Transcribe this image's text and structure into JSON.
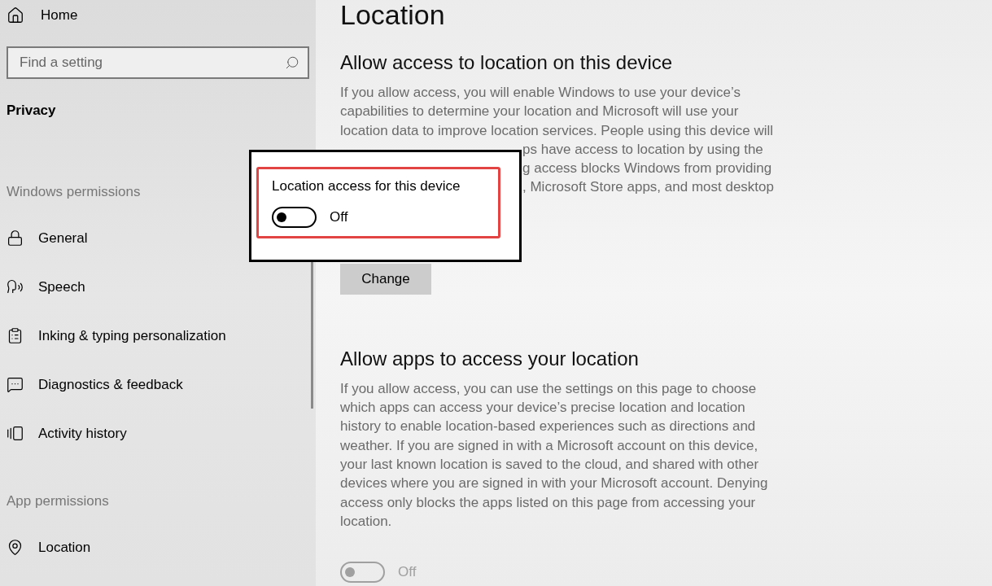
{
  "sidebar": {
    "home": {
      "label": "Home"
    },
    "search": {
      "placeholder": "Find a setting"
    },
    "section_title": "Privacy",
    "groups": [
      {
        "title": "Windows permissions",
        "items": [
          {
            "label": "General"
          },
          {
            "label": "Speech"
          },
          {
            "label": "Inking & typing personalization"
          },
          {
            "label": "Diagnostics & feedback"
          },
          {
            "label": "Activity history"
          }
        ]
      },
      {
        "title": "App permissions",
        "items": [
          {
            "label": "Location"
          }
        ]
      }
    ]
  },
  "main": {
    "title": "Location",
    "sections": [
      {
        "heading": "Allow access to location on this device",
        "paragraph_lines": [
          {
            "kind": "full",
            "text": "If you allow access, you will enable Windows to use your device’s"
          },
          {
            "kind": "full",
            "text": "capabilities to determine your location and Microsoft will use your"
          },
          {
            "kind": "full",
            "text": "location data to improve location services. People using this device will"
          },
          {
            "kind": "fragment",
            "text": "ps have access to location by using the"
          },
          {
            "kind": "fragment",
            "text": "g access blocks Windows from providing"
          },
          {
            "kind": "fragment",
            "text": ", Microsoft Store apps, and most desktop"
          }
        ],
        "button": "Change"
      },
      {
        "heading": "Allow apps to access your location",
        "paragraph": "If you allow access, you can use the settings on this page to choose which apps can access your device’s precise location and location history to enable location-based experiences such as directions and weather. If you are signed in with a Microsoft account on this device, your last known location is saved to the cloud, and shared with other devices where you are signed in with your Microsoft account. Denying access only blocks the apps listed on this page from accessing your location.",
        "toggle": {
          "on": false,
          "disabled": true,
          "label": "Off"
        }
      }
    ]
  },
  "callout": {
    "title": "Location access for this device",
    "toggle": {
      "on": false,
      "disabled": false,
      "label": "Off"
    }
  }
}
